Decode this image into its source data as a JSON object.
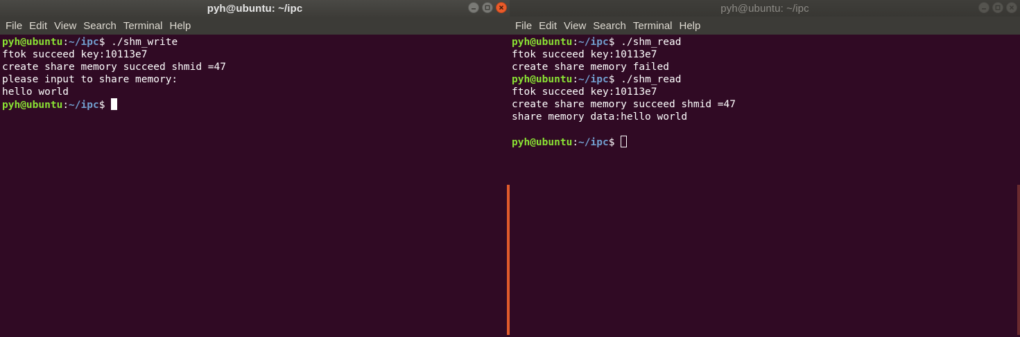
{
  "left_window": {
    "title": "pyh@ubuntu: ~/ipc",
    "menu": [
      "File",
      "Edit",
      "View",
      "Search",
      "Terminal",
      "Help"
    ],
    "lines": [
      {
        "prompt": true,
        "user": "pyh@ubuntu",
        "colon": ":",
        "path": "~/ipc",
        "dollar": "$ ",
        "text": "./shm_write"
      },
      {
        "prompt": false,
        "text": "ftok succeed key:10113e7"
      },
      {
        "prompt": false,
        "text": "create share memory succeed shmid =47"
      },
      {
        "prompt": false,
        "text": "please input to share memory:"
      },
      {
        "prompt": false,
        "text": "hello world"
      },
      {
        "prompt": true,
        "user": "pyh@ubuntu",
        "colon": ":",
        "path": "~/ipc",
        "dollar": "$ ",
        "text": "",
        "cursor": "solid"
      }
    ]
  },
  "right_window": {
    "title": "pyh@ubuntu: ~/ipc",
    "menu": [
      "File",
      "Edit",
      "View",
      "Search",
      "Terminal",
      "Help"
    ],
    "lines": [
      {
        "prompt": true,
        "user": "pyh@ubuntu",
        "colon": ":",
        "path": "~/ipc",
        "dollar": "$ ",
        "text": "./shm_read"
      },
      {
        "prompt": false,
        "text": "ftok succeed key:10113e7"
      },
      {
        "prompt": false,
        "text": "create share memory failed"
      },
      {
        "prompt": true,
        "user": "pyh@ubuntu",
        "colon": ":",
        "path": "~/ipc",
        "dollar": "$ ",
        "text": "./shm_read"
      },
      {
        "prompt": false,
        "text": "ftok succeed key:10113e7"
      },
      {
        "prompt": false,
        "text": "create share memory succeed shmid =47"
      },
      {
        "prompt": false,
        "text": "share memory data:hello world"
      },
      {
        "prompt": false,
        "text": ""
      },
      {
        "prompt": true,
        "user": "pyh@ubuntu",
        "colon": ":",
        "path": "~/ipc",
        "dollar": "$ ",
        "text": "",
        "cursor": "hollow"
      }
    ]
  },
  "colors": {
    "terminal_bg": "#300a24",
    "prompt_user": "#8ae234",
    "prompt_path": "#729fcf",
    "close_button": "#ea5b2a",
    "scroll_accent": "#e05a2b"
  },
  "icons": [
    "minimize-icon",
    "maximize-icon",
    "close-icon"
  ]
}
